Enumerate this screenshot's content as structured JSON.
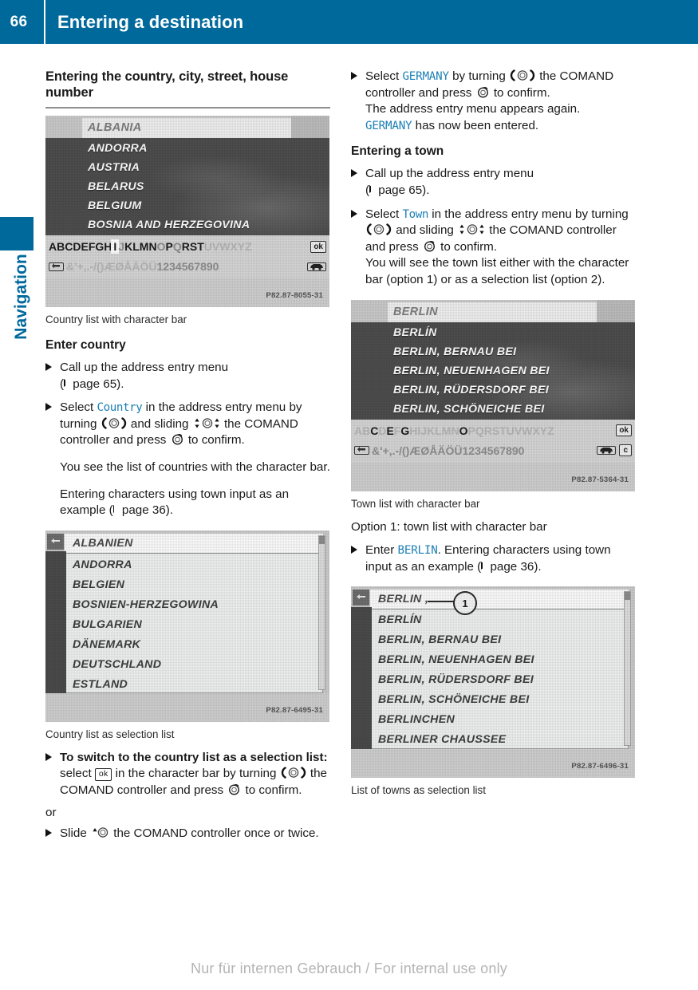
{
  "header": {
    "page_number": "66",
    "title": "Entering a destination",
    "accent_color": "#00699c"
  },
  "sidebar": {
    "tab_label": "Navigation"
  },
  "footer": {
    "watermark": "Nur für internen Gebrauch / For internal use only"
  },
  "left_column": {
    "section_title": "Entering the country, city, street, house number",
    "figure1": {
      "caption": "Country list with character bar",
      "code": "P82.87-8055-31",
      "highlight_row": "ALBANIA",
      "rows": [
        "ANDORRA",
        "AUSTRIA",
        "BELARUS",
        "BELGIUM",
        "BOSNIA AND HERZEGOVINA"
      ],
      "charbar_line1": "ABCDEFGHIJKLMNOPQRSTUVWXYZ",
      "charbar_cursor_char": "I",
      "charbar_line2": "&'+,.-/()ÆØÅÄÖÜ1234567890",
      "ok_label": "ok"
    },
    "subhead": "Enter country",
    "step1": {
      "text": "Call up the address entry menu",
      "ref_prefix": "(",
      "ref_text": " page 65).",
      "page_ref": "page 65"
    },
    "step2": {
      "pre": "Select ",
      "term": "Country",
      "mid1": " in the address entry menu by turning ",
      "mid2": " and sliding ",
      "mid3": " the COMAND controller and press ",
      "post": " to confirm.",
      "note1": "You see the list of countries with the character bar.",
      "note2_pre": "Entering characters using town input as an example (",
      "note2_post": " page 36)."
    },
    "figure2": {
      "caption": "Country list as selection list",
      "code": "P82.87-6495-31",
      "rows": [
        "ALBANIEN",
        "ANDORRA",
        "BELGIEN",
        "BOSNIEN-HERZEGOWINA",
        "BULGARIEN",
        "DÄNEMARK",
        "DEUTSCHLAND",
        "ESTLAND"
      ]
    },
    "step3": {
      "bold_lead": "To switch to the country list as a selection list:",
      "after_lead": " select ",
      "ok_label": "ok",
      "mid": " in the character bar by turning ",
      "mid2": " the COMAND controller and press ",
      "post": " to confirm."
    },
    "or_label": "or",
    "step4": {
      "pre": "Slide ",
      "post": " the COMAND controller once or twice."
    }
  },
  "right_column": {
    "step1": {
      "pre": "Select ",
      "term": "GERMANY",
      "mid": " by turning ",
      "mid2": " the COMAND controller and press ",
      "post": " to confirm.",
      "note1": "The address entry menu appears again.",
      "note2_term": "GERMANY",
      "note2_rest": " has now been entered."
    },
    "subhead": "Entering a town",
    "step2": {
      "text": "Call up the address entry menu",
      "ref_text": " page 65)."
    },
    "step3": {
      "pre": "Select ",
      "term": "Town",
      "mid1": " in the address entry menu by turning ",
      "mid2": " and sliding ",
      "mid3": " the COMAND controller and press ",
      "post": " to confirm.",
      "note": "You will see the town list either with the character bar (option 1) or as a selection list (option 2)."
    },
    "figure3": {
      "caption": "Town list with character bar",
      "code": "P82.87-5364-31",
      "highlight_row": "BERLIN",
      "rows": [
        "BERLÍN",
        "BERLIN, BERNAU BEI",
        "BERLIN, NEUENHAGEN BEI",
        "BERLIN, RÜDERSDORF BEI",
        "BERLIN, SCHÖNEICHE BEI"
      ],
      "charbar_line1": "ABCDEFGHIJKLMNOPQRSTUVWXYZ",
      "charbar_bold_chars": "CEGO",
      "charbar_line2": "&'+,.-/()ÆØÅÄÖÜ1234567890",
      "ok_label": "ok",
      "c_label": "c"
    },
    "option1_label": "Option 1: town list with character bar",
    "step4": {
      "pre": "Enter ",
      "term": "BERLIN",
      "post": ". Entering characters using town input as an example (",
      "post2": " page 36)."
    },
    "figure4": {
      "caption": "List of towns as selection list",
      "code": "P82.87-6496-31",
      "first_row": "BERLIN ,",
      "callout": "1",
      "rows": [
        "BERLÍN",
        "BERLIN, BERNAU BEI",
        "BERLIN, NEUENHAGEN BEI",
        "BERLIN, RÜDERSDORF BEI",
        "BERLIN, SCHÖNEICHE BEI",
        "BERLINCHEN",
        "BERLINER CHAUSSEE"
      ]
    }
  },
  "icons": {
    "turn": "comand-turn-icon",
    "slide_updown": "comand-slide-updown-icon",
    "slide_up": "comand-slide-up-icon",
    "press": "comand-press-icon",
    "page_arrow": "page-reference-arrow-icon"
  }
}
